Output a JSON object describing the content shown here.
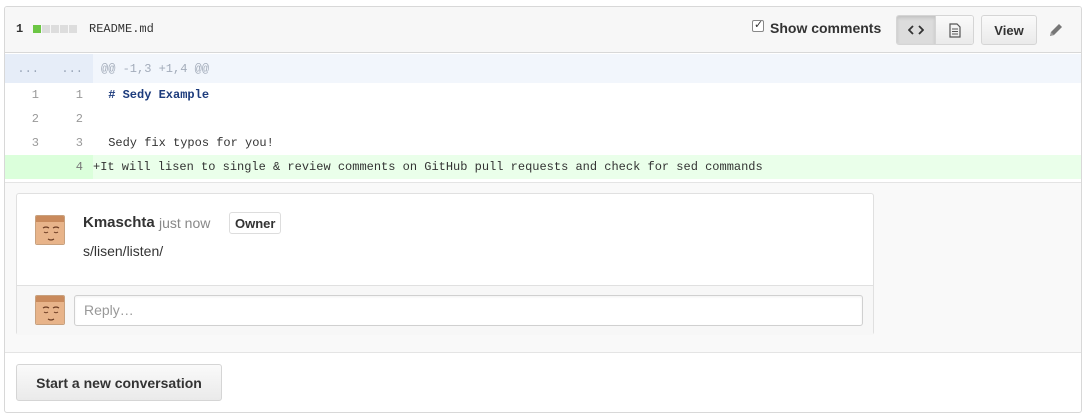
{
  "file_header": {
    "changes_count": "1",
    "diffstat": {
      "additions": 1,
      "total_blocks": 5
    },
    "file_name": "README.md",
    "show_comments": {
      "label": "Show comments",
      "checked": true
    },
    "view_button": "View",
    "icons": {
      "code_view": "code-icon",
      "rich_view": "file-text-icon",
      "edit": "pencil-icon"
    }
  },
  "diff": {
    "hunk": {
      "old": "...",
      "new": "...",
      "text": "@@ -1,3 +1,4 @@"
    },
    "lines": [
      {
        "old": "1",
        "new": "1",
        "text": " # Sedy Example",
        "type": "context-heading"
      },
      {
        "old": "2",
        "new": "2",
        "text": " ",
        "type": "context"
      },
      {
        "old": "3",
        "new": "3",
        "text": " Sedy fix typos for you!",
        "type": "context"
      },
      {
        "old": "",
        "new": "4",
        "text": "+It will lisen to single & review comments on GitHub pull requests and check for sed commands",
        "type": "add"
      }
    ]
  },
  "thread": {
    "comment": {
      "author": "Kmaschta",
      "timestamp": "just now",
      "badge": "Owner",
      "body": "s/lisen/listen/"
    },
    "reply": {
      "placeholder": "Reply…"
    }
  },
  "new_conversation_button": "Start a new conversation",
  "colors": {
    "addition": "#6cc644",
    "added_line_bg": "#eaffea",
    "hunk_bg": "#f2f6fc"
  }
}
